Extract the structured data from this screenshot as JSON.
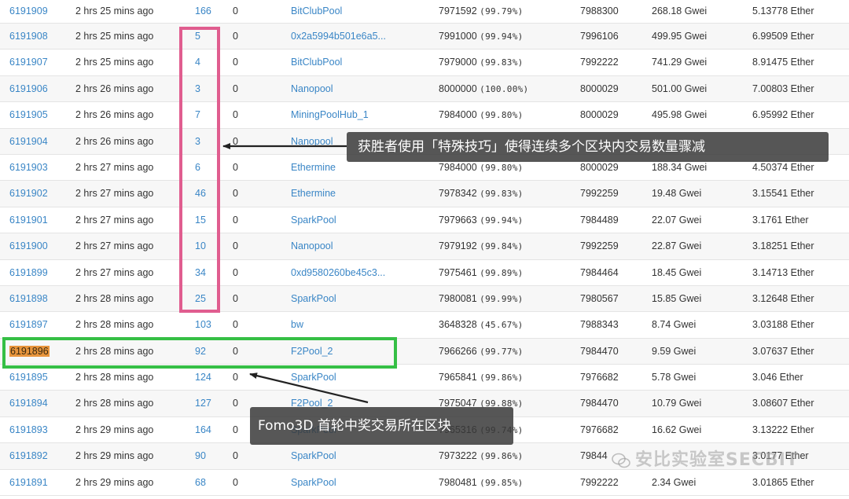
{
  "blocks": [
    {
      "block": "6191909",
      "age": "2 hrs 25 mins ago",
      "txn": "166",
      "uncles": "0",
      "miner": "BitClubPool",
      "gas_used": "7971592",
      "gas_pct": "(99.79%)",
      "gas_limit": "7988300",
      "gas_price": "268.18 Gwei",
      "reward": "5.13778 Ether"
    },
    {
      "block": "6191908",
      "age": "2 hrs 25 mins ago",
      "txn": "5",
      "uncles": "0",
      "miner": "0x2a5994b501e6a5...",
      "gas_used": "7991000",
      "gas_pct": "(99.94%)",
      "gas_limit": "7996106",
      "gas_price": "499.95 Gwei",
      "reward": "6.99509 Ether"
    },
    {
      "block": "6191907",
      "age": "2 hrs 25 mins ago",
      "txn": "4",
      "uncles": "0",
      "miner": "BitClubPool",
      "gas_used": "7979000",
      "gas_pct": "(99.83%)",
      "gas_limit": "7992222",
      "gas_price": "741.29 Gwei",
      "reward": "8.91475 Ether"
    },
    {
      "block": "6191906",
      "age": "2 hrs 26 mins ago",
      "txn": "3",
      "uncles": "0",
      "miner": "Nanopool",
      "gas_used": "8000000",
      "gas_pct": "(100.00%)",
      "gas_limit": "8000029",
      "gas_price": "501.00 Gwei",
      "reward": "7.00803 Ether"
    },
    {
      "block": "6191905",
      "age": "2 hrs 26 mins ago",
      "txn": "7",
      "uncles": "0",
      "miner": "MiningPoolHub_1",
      "gas_used": "7984000",
      "gas_pct": "(99.80%)",
      "gas_limit": "8000029",
      "gas_price": "495.98 Gwei",
      "reward": "6.95992 Ether"
    },
    {
      "block": "6191904",
      "age": "2 hrs 26 mins ago",
      "txn": "3",
      "uncles": "0",
      "miner": "Nanopool",
      "gas_used": "",
      "gas_pct": "",
      "gas_limit": "",
      "gas_price": "",
      "reward": ""
    },
    {
      "block": "6191903",
      "age": "2 hrs 27 mins ago",
      "txn": "6",
      "uncles": "0",
      "miner": "Ethermine",
      "gas_used": "7984000",
      "gas_pct": "(99.80%)",
      "gas_limit": "8000029",
      "gas_price": "188.34 Gwei",
      "reward": "4.50374 Ether"
    },
    {
      "block": "6191902",
      "age": "2 hrs 27 mins ago",
      "txn": "46",
      "uncles": "0",
      "miner": "Ethermine",
      "gas_used": "7978342",
      "gas_pct": "(99.83%)",
      "gas_limit": "7992259",
      "gas_price": "19.48 Gwei",
      "reward": "3.15541 Ether"
    },
    {
      "block": "6191901",
      "age": "2 hrs 27 mins ago",
      "txn": "15",
      "uncles": "0",
      "miner": "SparkPool",
      "gas_used": "7979663",
      "gas_pct": "(99.94%)",
      "gas_limit": "7984489",
      "gas_price": "22.07 Gwei",
      "reward": "3.1761 Ether"
    },
    {
      "block": "6191900",
      "age": "2 hrs 27 mins ago",
      "txn": "10",
      "uncles": "0",
      "miner": "Nanopool",
      "gas_used": "7979192",
      "gas_pct": "(99.84%)",
      "gas_limit": "7992259",
      "gas_price": "22.87 Gwei",
      "reward": "3.18251 Ether"
    },
    {
      "block": "6191899",
      "age": "2 hrs 27 mins ago",
      "txn": "34",
      "uncles": "0",
      "miner": "0xd9580260be45c3...",
      "gas_used": "7975461",
      "gas_pct": "(99.89%)",
      "gas_limit": "7984464",
      "gas_price": "18.45 Gwei",
      "reward": "3.14713 Ether"
    },
    {
      "block": "6191898",
      "age": "2 hrs 28 mins ago",
      "txn": "25",
      "uncles": "0",
      "miner": "SparkPool",
      "gas_used": "7980081",
      "gas_pct": "(99.99%)",
      "gas_limit": "7980567",
      "gas_price": "15.85 Gwei",
      "reward": "3.12648 Ether"
    },
    {
      "block": "6191897",
      "age": "2 hrs 28 mins ago",
      "txn": "103",
      "uncles": "0",
      "miner": "bw",
      "gas_used": "3648328",
      "gas_pct": "(45.67%)",
      "gas_limit": "7988343",
      "gas_price": "8.74 Gwei",
      "reward": "3.03188 Ether"
    },
    {
      "block": "6191896",
      "age": "2 hrs 28 mins ago",
      "txn": "92",
      "uncles": "0",
      "miner": "F2Pool_2",
      "gas_used": "7966266",
      "gas_pct": "(99.77%)",
      "gas_limit": "7984470",
      "gas_price": "9.59 Gwei",
      "reward": "3.07637 Ether"
    },
    {
      "block": "6191895",
      "age": "2 hrs 28 mins ago",
      "txn": "124",
      "uncles": "0",
      "miner": "SparkPool",
      "gas_used": "7965841",
      "gas_pct": "(99.86%)",
      "gas_limit": "7976682",
      "gas_price": "5.78 Gwei",
      "reward": "3.046 Ether"
    },
    {
      "block": "6191894",
      "age": "2 hrs 28 mins ago",
      "txn": "127",
      "uncles": "0",
      "miner": "F2Pool_2",
      "gas_used": "7975047",
      "gas_pct": "(99.88%)",
      "gas_limit": "7984470",
      "gas_price": "10.79 Gwei",
      "reward": "3.08607 Ether"
    },
    {
      "block": "6191893",
      "age": "2 hrs 29 mins ago",
      "txn": "164",
      "uncles": "0",
      "miner": "SparkPool",
      "gas_used": "7965316",
      "gas_pct": "(99.74%)",
      "gas_limit": "7976682",
      "gas_price": "16.62 Gwei",
      "reward": "3.13222 Ether"
    },
    {
      "block": "6191892",
      "age": "2 hrs 29 mins ago",
      "txn": "90",
      "uncles": "0",
      "miner": "SparkPool",
      "gas_used": "7973222",
      "gas_pct": "(99.86%)",
      "gas_limit": "79844",
      "gas_price": "",
      "reward": "3.0177 Ether"
    },
    {
      "block": "6191891",
      "age": "2 hrs 29 mins ago",
      "txn": "68",
      "uncles": "0",
      "miner": "SparkPool",
      "gas_used": "7980481",
      "gas_pct": "(99.85%)",
      "gas_limit": "7992222",
      "gas_price": "2.34 Gwei",
      "reward": "3.01865 Ether"
    }
  ],
  "highlighted_block": "6191896",
  "annotations": {
    "callout_top": "获胜者使用「特殊技巧」使得连续多个区块内交易数量骤减",
    "callout_bottom": "Fomo3D 首轮中奖交易所在区块"
  },
  "watermark": {
    "text": "安比实验室SECBIT",
    "icon": "wechat-logo-icon"
  },
  "colors": {
    "link": "#3a86c6",
    "pink_box": "#e05d8f",
    "green_box": "#35bf45",
    "highlight": "#e8953c",
    "callout_bg": "#3a3a3a"
  }
}
